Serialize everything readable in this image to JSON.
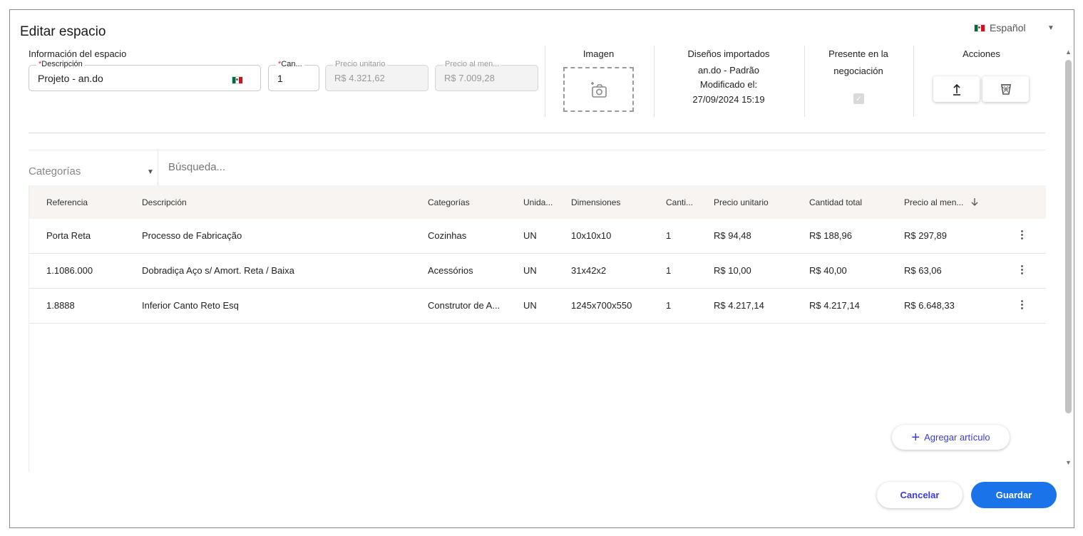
{
  "dialog": {
    "title": "Editar espacio"
  },
  "language": {
    "selected": "Español"
  },
  "space_info": {
    "section_label": "Información del espacio",
    "description": {
      "label": "Descripción",
      "value": "Projeto - an.do"
    },
    "quantity": {
      "label": "Can...",
      "value": "1"
    },
    "unit_price": {
      "label": "Precio unitario",
      "value": "R$ 4.321,62"
    },
    "retail_price": {
      "label": "Precio al men...",
      "value": "R$ 7.009,28"
    }
  },
  "image": {
    "title": "Imagen"
  },
  "imported_designs": {
    "title": "Diseños importados",
    "name": "an.do - Padrão",
    "modified_label": "Modificado el:",
    "modified_date": "27/09/2024 15:19"
  },
  "negotiation": {
    "title_line1": "Presente en la",
    "title_line2": "negociación",
    "checked": true
  },
  "actions": {
    "title": "Acciones"
  },
  "filters": {
    "categories_placeholder": "Categorías",
    "search_placeholder": "Búsqueda..."
  },
  "table": {
    "headers": [
      "Referencia",
      "Descripción",
      "Categorías",
      "Unida...",
      "Dimensiones",
      "Canti...",
      "Precio unitario",
      "Cantidad total",
      "Precio al men..."
    ],
    "rows": [
      [
        "Porta Reta",
        "Processo de Fabricação",
        "Cozinhas",
        "UN",
        "10x10x10",
        "1",
        "R$ 94,48",
        "R$ 188,96",
        "R$ 297,89"
      ],
      [
        "1.1086.000",
        "Dobradiça Aço s/ Amort. Reta / Baixa",
        "Acessórios",
        "UN",
        "31x42x2",
        "1",
        "R$ 10,00",
        "R$ 40,00",
        "R$ 63,06"
      ],
      [
        "1.8888",
        "Inferior Canto Reto Esq",
        "Construtor de A...",
        "UN",
        "1245x700x550",
        "1",
        "R$ 4.217,14",
        "R$ 4.217,14",
        "R$ 6.648,33"
      ]
    ]
  },
  "buttons": {
    "add_item": "Agregar artículo",
    "cancel": "Cancelar",
    "save": "Guardar"
  },
  "colors": {
    "primary": "#1a73e8",
    "link": "#3b3bd8",
    "table_header_bg": "#f7f4f1"
  }
}
